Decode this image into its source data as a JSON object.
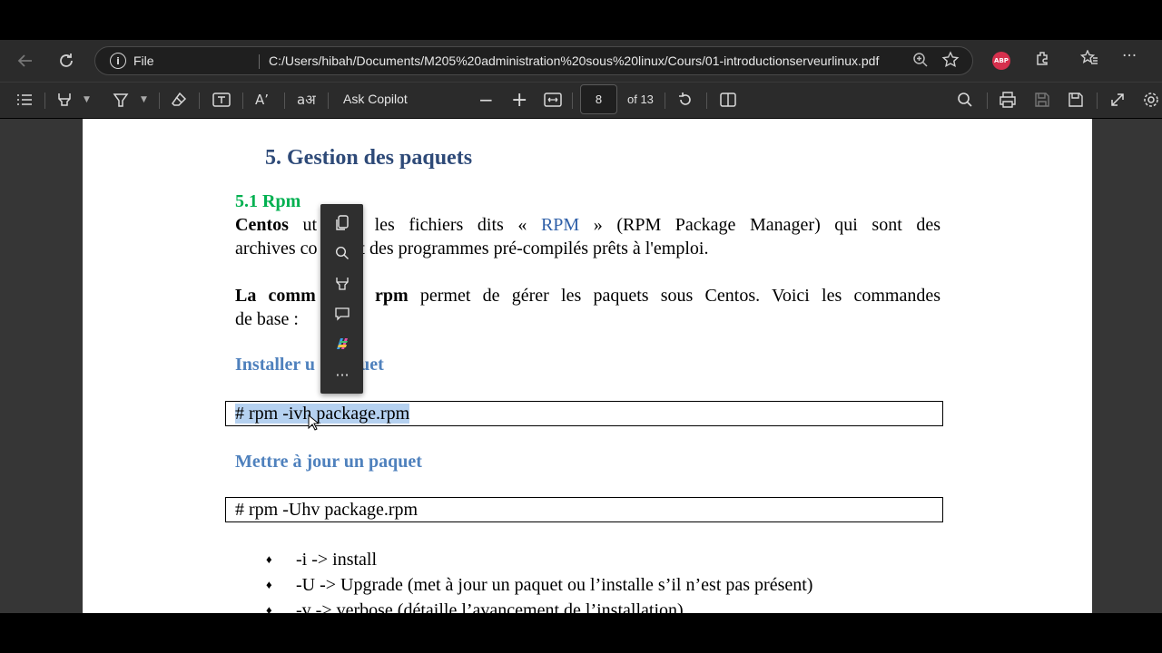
{
  "browser": {
    "scheme_label": "File",
    "url": "C:/Users/hibah/Documents/M205%20administration%20sous%20linux/Cours/01-introductionserveurlinux.pdf",
    "extension_badge": "ABP",
    "icons": [
      "back-icon",
      "refresh-icon",
      "info-icon",
      "zoom-icon",
      "favorite-star-icon",
      "abp-extension-icon",
      "extensions-icon",
      "favorites-icon",
      "more-icon"
    ]
  },
  "pdf_toolbar": {
    "ask_copilot": "Ask Copilot",
    "zoom_out": "−",
    "zoom_in": "+",
    "current_page": "8",
    "total_pages": "of 13"
  },
  "document": {
    "heading": "5.  Gestion des paquets",
    "subheading": "5.1 Rpm",
    "para1_bold": "Centos",
    "para1_a": " ut",
    "para1_b": " les fichiers dits « ",
    "para1_rpm": "RPM",
    "para1_c": " » (RPM Package Manager) qui sont des",
    "para1_line2a": "archives co",
    "para1_line2b": "ant des programmes pré-compilés prêts à l'emploi.",
    "para2_bold_a": "La comm",
    "para2_bold_b": " rpm",
    "para2_rest": "  permet de gérer les paquets sous Centos. Voici les commandes",
    "para2_line2": "de base :",
    "install_heading": "Installer u",
    "install_heading_end": "quet",
    "install_cmd": "# rpm -ivh package.rpm",
    "update_heading": "Mettre à jour un paquet",
    "update_cmd": "# rpm -Uhv package.rpm",
    "bullets": [
      "-i -> install",
      "-U -> Upgrade (met à jour un paquet ou l’installe s’il n’est pas présent)",
      "-v -> verbose (détaille l’avancement de l’installation)"
    ]
  },
  "floating_menu": {
    "items": [
      "copy-icon",
      "search-icon",
      "highlight-icon",
      "comment-icon",
      "copilot-icon",
      "more-options-icon"
    ],
    "more_label": "···"
  },
  "colors": {
    "heading": "#2e4a78",
    "subheading": "#00b050",
    "section": "#4f81bd",
    "selection": "#b5d1f0"
  }
}
